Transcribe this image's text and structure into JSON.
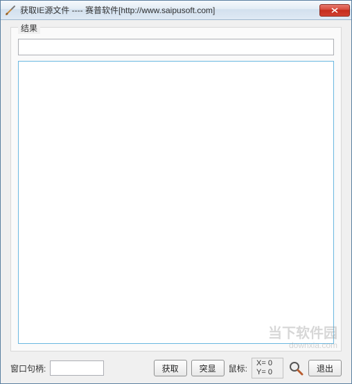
{
  "window": {
    "title": "获取IE源文件 ---- 赛普软件[http://www.saipusoft.com]"
  },
  "group": {
    "label": "结果"
  },
  "result": {
    "value": ""
  },
  "textarea": {
    "value": ""
  },
  "bottom": {
    "handle_label": "窗口句柄:",
    "handle_value": "",
    "get_btn": "获取",
    "highlight_btn": "突显",
    "mouse_label": "鼠标:",
    "mouse_x": "X= 0",
    "mouse_y": "Y= 0",
    "exit_btn": "退出"
  },
  "watermark": {
    "main": "当下软件园",
    "sub": "downxia.com"
  }
}
